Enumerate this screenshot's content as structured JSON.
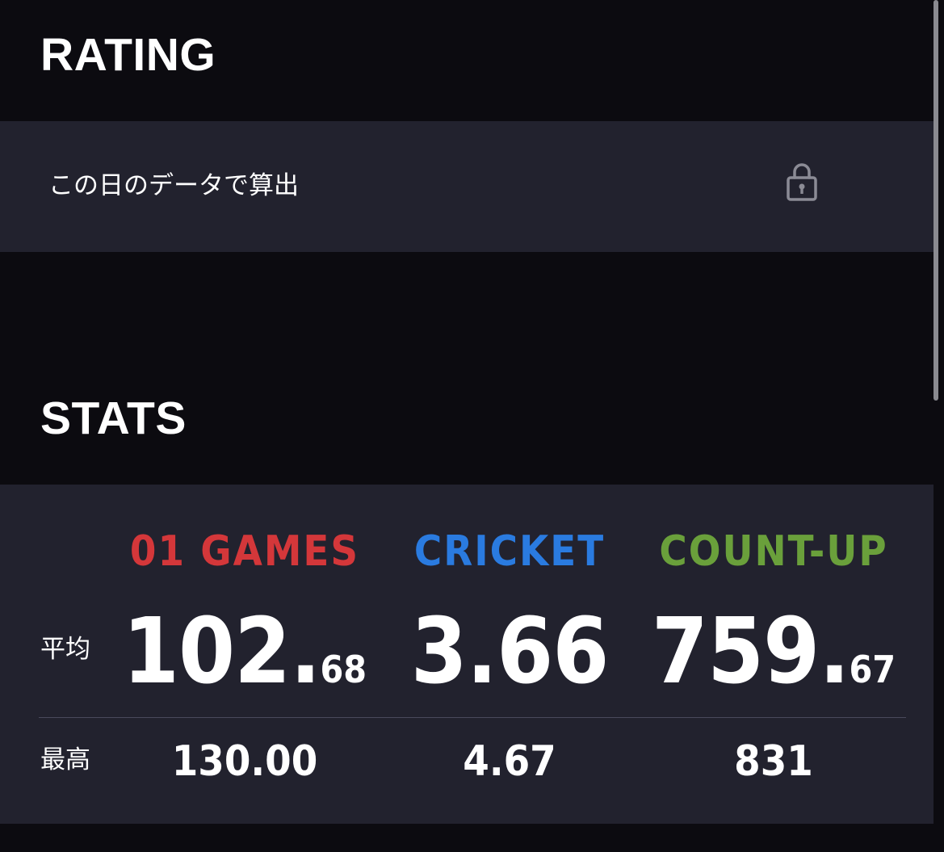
{
  "rating": {
    "title": "RATING",
    "row_label": "この日のデータで算出",
    "lock_icon": "lock-icon"
  },
  "stats": {
    "title": "STATS",
    "row_labels": {
      "average": "平均",
      "best": "最高"
    },
    "columns": [
      {
        "name": "01 GAMES",
        "color": "#d4373a",
        "average_int": "102.",
        "average_dec": "68",
        "best": "130.00"
      },
      {
        "name": "CRICKET",
        "color": "#2a7be0",
        "average_int": "3.66",
        "average_dec": "",
        "best": "4.67"
      },
      {
        "name": "COUNT-UP",
        "color": "#6aa03b",
        "average_int": "759.",
        "average_dec": "67",
        "best": "831"
      }
    ]
  }
}
